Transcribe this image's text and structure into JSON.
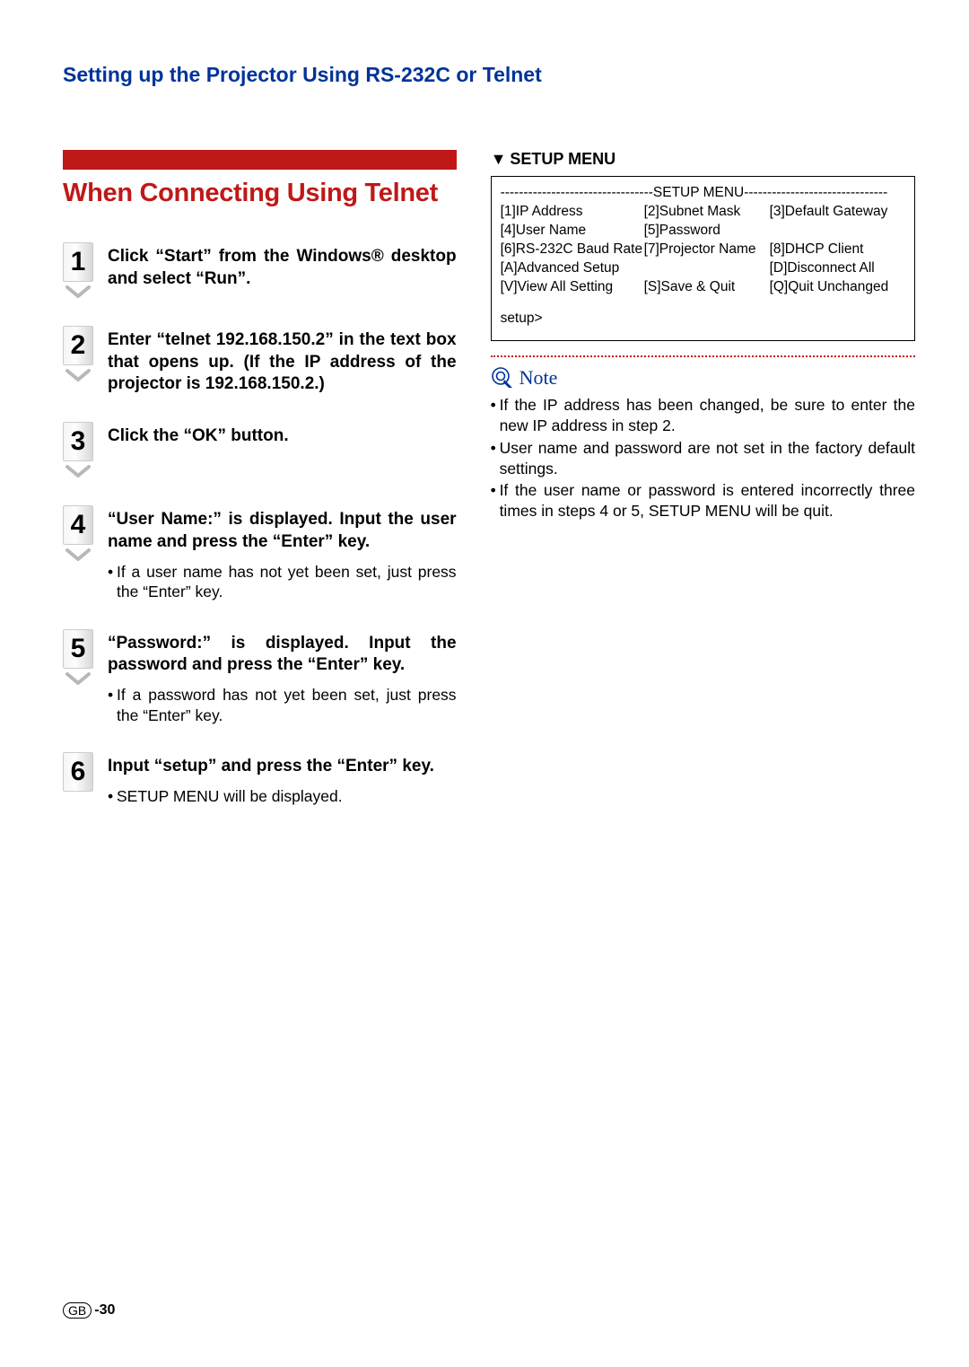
{
  "heading": "Setting up the Projector Using RS-232C or Telnet",
  "section_title": "When Connecting Using Telnet",
  "steps": [
    {
      "num": "1",
      "main": "Click “Start” from the Windows® desktop and select “Run”.",
      "sub": []
    },
    {
      "num": "2",
      "main": "Enter “telnet 192.168.150.2” in the text box that opens up. (If the IP address of the projector is 192.168.150.2.)",
      "sub": []
    },
    {
      "num": "3",
      "main": "Click the “OK” button.",
      "sub": []
    },
    {
      "num": "4",
      "main": "“User Name:” is displayed. Input the user name and press the “Enter” key.",
      "sub": [
        "If a user name has not yet been set, just press the “Enter” key."
      ]
    },
    {
      "num": "5",
      "main": "“Password:” is displayed. Input the password and press the “Enter” key.",
      "sub": [
        "If a password has not yet been set, just press the “Enter” key."
      ]
    },
    {
      "num": "6",
      "main": "Input “setup” and press the “Enter” key.",
      "sub": [
        "SETUP MENU will be displayed."
      ]
    }
  ],
  "setup_menu": {
    "label": "SETUP MENU",
    "header": "---------------------------------SETUP MENU-------------------------------",
    "rows": [
      [
        "[1]IP Address",
        "[2]Subnet Mask",
        "[3]Default Gateway"
      ],
      [
        "[4]User Name",
        "[5]Password",
        ""
      ],
      [
        "[6]RS-232C Baud Rate",
        "[7]Projector Name",
        "[8]DHCP Client"
      ],
      [
        "[A]Advanced Setup",
        "",
        "[D]Disconnect All"
      ],
      [
        "[V]View All Setting",
        "[S]Save & Quit",
        "[Q]Quit Unchanged"
      ]
    ],
    "prompt": "setup>"
  },
  "note_label": "Note",
  "notes": [
    "If the IP address has been changed, be sure to enter the new IP address in step 2.",
    "User name and password are not set in the factory default settings.",
    "If the user name or password is entered incorrectly three times in steps 4 or 5, SETUP MENU will be quit."
  ],
  "footer": {
    "gb": "GB",
    "page": "-30"
  }
}
